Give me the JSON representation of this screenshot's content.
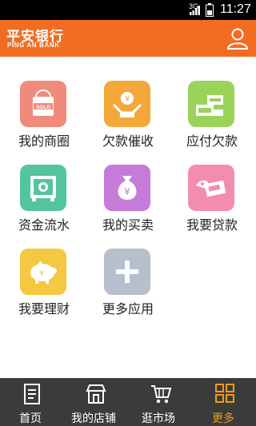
{
  "status_bar": {
    "network": "3G",
    "time": "11:27"
  },
  "header": {
    "logo_cn": "平安银行",
    "logo_en": "PING AN BANK",
    "user_icon": "user-icon"
  },
  "grid": [
    {
      "label": "我的商圈",
      "color": "#f08a7a",
      "icon": "shopping-bag-icon",
      "badge": "SOLD"
    },
    {
      "label": "欠款催收",
      "color": "#f5a83a",
      "icon": "money-hand-icon"
    },
    {
      "label": "应付欠款",
      "color": "#9bd35a",
      "icon": "cash-payment-icon"
    },
    {
      "label": "资金流水",
      "color": "#53c4a0",
      "icon": "safe-icon"
    },
    {
      "label": "我的买卖",
      "color": "#c77bd9",
      "icon": "money-bag-icon",
      "symbol": "¥"
    },
    {
      "label": "我要贷款",
      "color": "#f28cb0",
      "icon": "loan-icon"
    },
    {
      "label": "我要理财",
      "color": "#f5c842",
      "icon": "piggy-bank-icon",
      "symbol": "¥"
    },
    {
      "label": "更多应用",
      "color": "#b7bfcc",
      "icon": "plus-icon"
    }
  ],
  "bottom_nav": [
    {
      "label": "首页",
      "icon": "home-document-icon",
      "active": false
    },
    {
      "label": "我的店铺",
      "icon": "store-icon",
      "active": false
    },
    {
      "label": "逛市场",
      "icon": "shopping-cart-icon",
      "active": false
    },
    {
      "label": "更多",
      "icon": "grid-icon",
      "active": true
    }
  ],
  "colors": {
    "brand_orange": "#f26d21",
    "nav_bg": "#3b3b3b",
    "active_nav": "#f39c12"
  }
}
